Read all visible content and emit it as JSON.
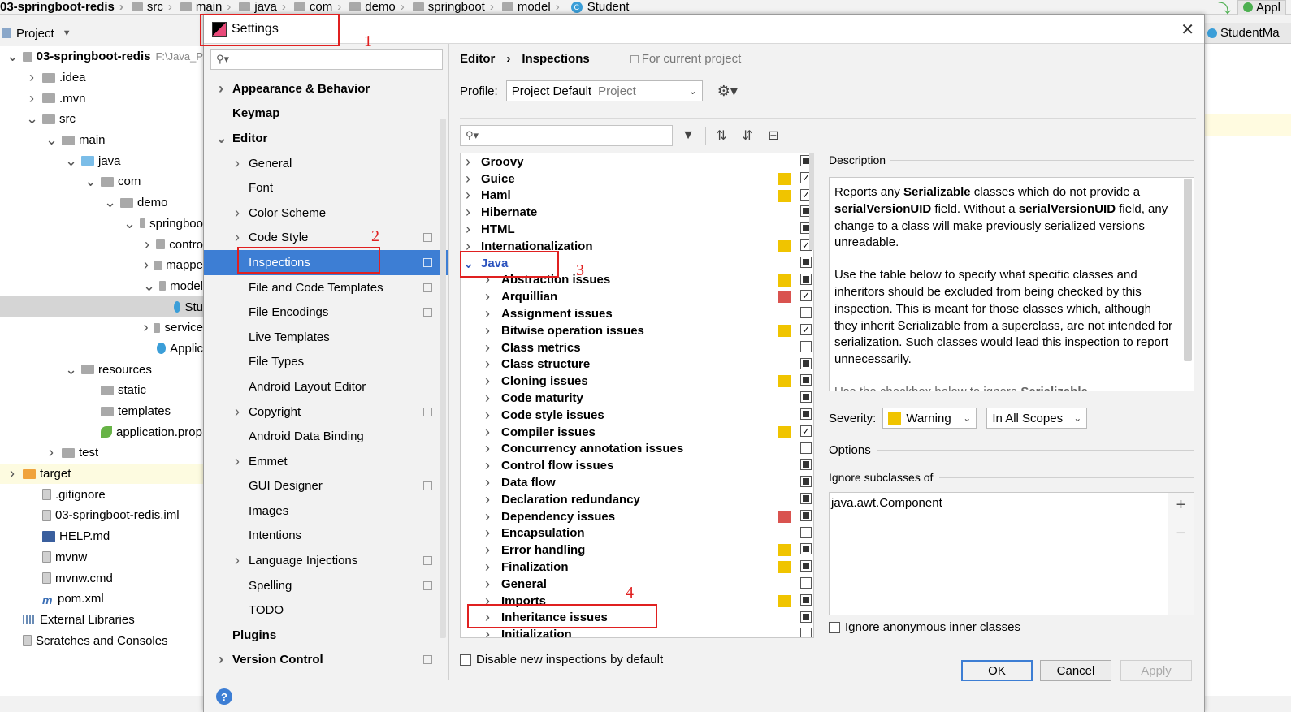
{
  "ide": {
    "breadcrumb": [
      "03-springboot-redis",
      "src",
      "main",
      "java",
      "com",
      "demo",
      "springboot",
      "model",
      "Student"
    ],
    "top_right_run": "Appl",
    "project_label": "Project",
    "editor_tab": "StudentMa",
    "project_tree": [
      {
        "label": "03-springboot-redis",
        "path": "F:\\Java_P",
        "indent": 0,
        "arrow": "v",
        "icon": "folder",
        "bold": true
      },
      {
        "label": ".idea",
        "indent": 1,
        "arrow": ">",
        "icon": "folder"
      },
      {
        "label": ".mvn",
        "indent": 1,
        "arrow": ">",
        "icon": "folder"
      },
      {
        "label": "src",
        "indent": 1,
        "arrow": "v",
        "icon": "folder"
      },
      {
        "label": "main",
        "indent": 2,
        "arrow": "v",
        "icon": "folder"
      },
      {
        "label": "java",
        "indent": 3,
        "arrow": "v",
        "icon": "folder-blue"
      },
      {
        "label": "com",
        "indent": 4,
        "arrow": "v",
        "icon": "folder"
      },
      {
        "label": "demo",
        "indent": 5,
        "arrow": "v",
        "icon": "folder"
      },
      {
        "label": "springboo",
        "indent": 6,
        "arrow": "v",
        "icon": "folder"
      },
      {
        "label": "contro",
        "indent": 7,
        "arrow": ">",
        "icon": "folder"
      },
      {
        "label": "mappe",
        "indent": 7,
        "arrow": ">",
        "icon": "folder"
      },
      {
        "label": "model",
        "indent": 7,
        "arrow": "v",
        "icon": "folder"
      },
      {
        "label": "Stu",
        "indent": 8,
        "arrow": "",
        "icon": "class",
        "selected": true
      },
      {
        "label": "service",
        "indent": 7,
        "arrow": ">",
        "icon": "folder"
      },
      {
        "label": "Applic",
        "indent": 7,
        "arrow": "",
        "icon": "class"
      },
      {
        "label": "resources",
        "indent": 3,
        "arrow": "v",
        "icon": "folder"
      },
      {
        "label": "static",
        "indent": 4,
        "arrow": "",
        "icon": "folder"
      },
      {
        "label": "templates",
        "indent": 4,
        "arrow": "",
        "icon": "folder"
      },
      {
        "label": "application.prop",
        "indent": 4,
        "arrow": "",
        "icon": "leaf"
      },
      {
        "label": "test",
        "indent": 2,
        "arrow": ">",
        "icon": "folder"
      },
      {
        "label": "target",
        "indent": 0,
        "arrow": ">",
        "icon": "folder-orange",
        "highlight": true
      },
      {
        "label": ".gitignore",
        "indent": 1,
        "arrow": "",
        "icon": "file"
      },
      {
        "label": "03-springboot-redis.iml",
        "indent": 1,
        "arrow": "",
        "icon": "file"
      },
      {
        "label": "HELP.md",
        "indent": 1,
        "arrow": "",
        "icon": "md"
      },
      {
        "label": "mvnw",
        "indent": 1,
        "arrow": "",
        "icon": "file"
      },
      {
        "label": "mvnw.cmd",
        "indent": 1,
        "arrow": "",
        "icon": "file"
      },
      {
        "label": "pom.xml",
        "indent": 1,
        "arrow": "",
        "icon": "maven"
      },
      {
        "label": "External Libraries",
        "indent": 0,
        "arrow": "",
        "icon": "lib"
      },
      {
        "label": "Scratches and Consoles",
        "indent": 0,
        "arrow": "",
        "icon": "scratch"
      }
    ]
  },
  "dialog": {
    "title": "Settings",
    "nav": [
      {
        "label": "Appearance & Behavior",
        "level": 0,
        "arrow": ">",
        "bold": true
      },
      {
        "label": "Keymap",
        "level": 0,
        "arrow": "",
        "bold": true
      },
      {
        "label": "Editor",
        "level": 0,
        "arrow": "v",
        "bold": true
      },
      {
        "label": "General",
        "level": 1,
        "arrow": ">"
      },
      {
        "label": "Font",
        "level": 1,
        "arrow": ""
      },
      {
        "label": "Color Scheme",
        "level": 1,
        "arrow": ">"
      },
      {
        "label": "Code Style",
        "level": 1,
        "arrow": ">",
        "proj": true
      },
      {
        "label": "Inspections",
        "level": 1,
        "arrow": "",
        "proj": true,
        "selected": true
      },
      {
        "label": "File and Code Templates",
        "level": 1,
        "arrow": "",
        "proj": true
      },
      {
        "label": "File Encodings",
        "level": 1,
        "arrow": "",
        "proj": true
      },
      {
        "label": "Live Templates",
        "level": 1,
        "arrow": ""
      },
      {
        "label": "File Types",
        "level": 1,
        "arrow": ""
      },
      {
        "label": "Android Layout Editor",
        "level": 1,
        "arrow": ""
      },
      {
        "label": "Copyright",
        "level": 1,
        "arrow": ">",
        "proj": true
      },
      {
        "label": "Android Data Binding",
        "level": 1,
        "arrow": ""
      },
      {
        "label": "Emmet",
        "level": 1,
        "arrow": ">"
      },
      {
        "label": "GUI Designer",
        "level": 1,
        "arrow": "",
        "proj": true
      },
      {
        "label": "Images",
        "level": 1,
        "arrow": ""
      },
      {
        "label": "Intentions",
        "level": 1,
        "arrow": ""
      },
      {
        "label": "Language Injections",
        "level": 1,
        "arrow": ">",
        "proj": true
      },
      {
        "label": "Spelling",
        "level": 1,
        "arrow": "",
        "proj": true
      },
      {
        "label": "TODO",
        "level": 1,
        "arrow": ""
      },
      {
        "label": "Plugins",
        "level": 0,
        "arrow": "",
        "bold": true
      },
      {
        "label": "Version Control",
        "level": 0,
        "arrow": ">",
        "bold": true,
        "proj": true
      }
    ],
    "breadcrumb": {
      "parent": "Editor",
      "sep": "›",
      "current": "Inspections",
      "scope_note": "For current project"
    },
    "profile": {
      "label": "Profile:",
      "value": "Project Default",
      "kind": "Project"
    },
    "inspections": [
      {
        "label": "Groovy",
        "level": 0,
        "sev": "",
        "check": "full"
      },
      {
        "label": "Guice",
        "level": 0,
        "sev": "warning",
        "check": "checked"
      },
      {
        "label": "Haml",
        "level": 0,
        "sev": "warning",
        "check": "checked"
      },
      {
        "label": "Hibernate",
        "level": 0,
        "sev": "",
        "check": "full"
      },
      {
        "label": "HTML",
        "level": 0,
        "sev": "",
        "check": "full"
      },
      {
        "label": "Internationalization",
        "level": 0,
        "sev": "warning",
        "check": "checked"
      },
      {
        "label": "Java",
        "level": 0,
        "sev": "",
        "check": "full",
        "expanded": true
      },
      {
        "label": "Abstraction issues",
        "level": 1,
        "sev": "warning",
        "check": "full"
      },
      {
        "label": "Arquillian",
        "level": 1,
        "sev": "error",
        "check": "checked"
      },
      {
        "label": "Assignment issues",
        "level": 1,
        "sev": "",
        "check": "empty"
      },
      {
        "label": "Bitwise operation issues",
        "level": 1,
        "sev": "warning",
        "check": "checked"
      },
      {
        "label": "Class metrics",
        "level": 1,
        "sev": "",
        "check": "empty"
      },
      {
        "label": "Class structure",
        "level": 1,
        "sev": "",
        "check": "full"
      },
      {
        "label": "Cloning issues",
        "level": 1,
        "sev": "warning",
        "check": "full"
      },
      {
        "label": "Code maturity",
        "level": 1,
        "sev": "",
        "check": "full"
      },
      {
        "label": "Code style issues",
        "level": 1,
        "sev": "",
        "check": "full"
      },
      {
        "label": "Compiler issues",
        "level": 1,
        "sev": "warning",
        "check": "checked"
      },
      {
        "label": "Concurrency annotation issues",
        "level": 1,
        "sev": "",
        "check": "empty"
      },
      {
        "label": "Control flow issues",
        "level": 1,
        "sev": "",
        "check": "full"
      },
      {
        "label": "Data flow",
        "level": 1,
        "sev": "",
        "check": "full"
      },
      {
        "label": "Declaration redundancy",
        "level": 1,
        "sev": "",
        "check": "full"
      },
      {
        "label": "Dependency issues",
        "level": 1,
        "sev": "error",
        "check": "full"
      },
      {
        "label": "Encapsulation",
        "level": 1,
        "sev": "",
        "check": "empty"
      },
      {
        "label": "Error handling",
        "level": 1,
        "sev": "warning",
        "check": "full"
      },
      {
        "label": "Finalization",
        "level": 1,
        "sev": "warning",
        "check": "full"
      },
      {
        "label": "General",
        "level": 1,
        "sev": "",
        "check": "empty"
      },
      {
        "label": "Imports",
        "level": 1,
        "sev": "warning",
        "check": "full"
      },
      {
        "label": "Inheritance issues",
        "level": 1,
        "sev": "",
        "check": "full"
      },
      {
        "label": "Initialization",
        "level": 1,
        "sev": "",
        "check": "empty"
      }
    ],
    "disable_new_label": "Disable new inspections by default",
    "description": {
      "title": "Description",
      "para1_a": "Reports any ",
      "para1_b": "Serializable",
      "para1_c": " classes which do not provide a ",
      "para1_d": "serialVersionUID",
      "para1_e": " field. Without a ",
      "para1_f": "serialVersionUID",
      "para1_g": " field, any change to a class will make previously serialized versions unreadable.",
      "para2": "Use the table below to specify what specific classes and inheritors should be excluded from being checked by this inspection. This is meant for those classes which, although they inherit Serializable from a superclass, are not intended for serialization. Such classes would lead this inspection to report unnecessarily.",
      "para3_a": "Use the checkbox below to ignore ",
      "para3_b": "Serializable"
    },
    "severity": {
      "label": "Severity:",
      "value": "Warning",
      "scope": "In All Scopes"
    },
    "options_title": "Options",
    "ignore_subclasses_title": "Ignore subclasses of",
    "ignore_list": [
      "java.awt.Component"
    ],
    "add_symbol": "+",
    "remove_symbol": "−",
    "ignore_anonymous_label": "Ignore anonymous inner classes",
    "buttons": {
      "ok": "OK",
      "cancel": "Cancel",
      "apply": "Apply"
    },
    "help_symbol": "?"
  },
  "annotations": [
    "1",
    "2",
    "3",
    "4"
  ],
  "colors": {
    "selection": "#3d7ed4",
    "warning": "#f0c400",
    "error": "#d9534f",
    "annotation": "#e02020"
  }
}
